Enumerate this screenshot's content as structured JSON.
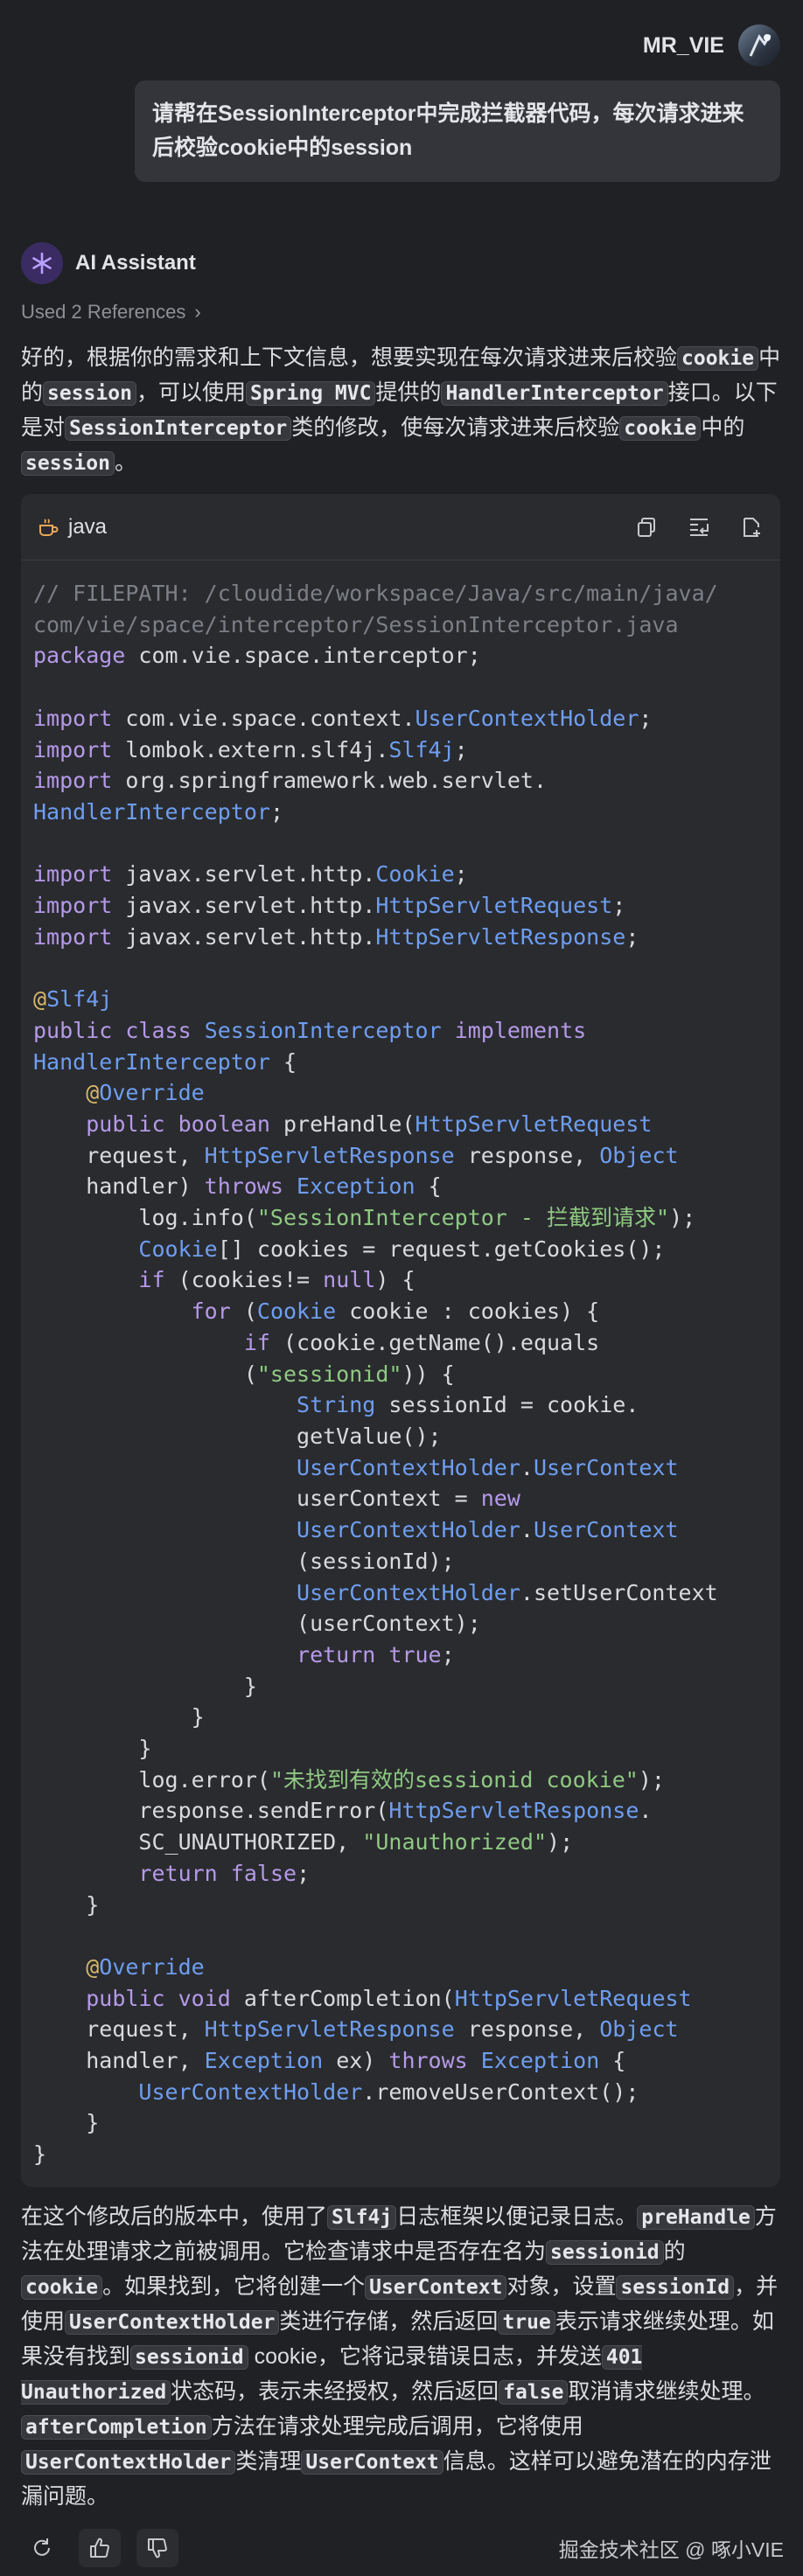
{
  "user": {
    "name": "MR_VIE",
    "message": "请帮在SessionInterceptor中完成拦截器代码，每次请求进来后校验cookie中的session"
  },
  "assistant": {
    "name": "AI Assistant",
    "references": "Used 2 References"
  },
  "intro": {
    "t1": "好的，根据你的需求和上下文信息，想要实现在每次请求进来后校验",
    "c1": "cookie",
    "t2": "中的",
    "c2": "session",
    "t3": "，可以使用",
    "c3": "Spring MVC",
    "t4": "提供的",
    "c4": "HandlerInterceptor",
    "t5": "接口。以下是对",
    "c5": "SessionInterceptor",
    "t6": "类的修改，使每次请求进来后校验",
    "c6": "cookie",
    "t7": "中的",
    "c7": "session",
    "t8": "。"
  },
  "code_block": {
    "language": "java",
    "language_icon": "coffee-cup-icon",
    "actions": [
      "copy-icon",
      "insert-icon",
      "new-file-icon"
    ],
    "lines": [
      "// FILEPATH: /cloudide/workspace/Java/src/main/java/",
      "com/vie/space/interceptor/SessionInterceptor.java",
      "package com.vie.space.interceptor;",
      "",
      "import com.vie.space.context.UserContextHolder;",
      "import lombok.extern.slf4j.Slf4j;",
      "import org.springframework.web.servlet.",
      "HandlerInterceptor;",
      "",
      "import javax.servlet.http.Cookie;",
      "import javax.servlet.http.HttpServletRequest;",
      "import javax.servlet.http.HttpServletResponse;",
      "",
      "@Slf4j",
      "public class SessionInterceptor implements",
      "HandlerInterceptor {",
      "    @Override",
      "    public boolean preHandle(HttpServletRequest",
      "    request, HttpServletResponse response, Object",
      "    handler) throws Exception {",
      "        log.info(\"SessionInterceptor - 拦截到请求\");",
      "        Cookie[] cookies = request.getCookies();",
      "        if (cookies!= null) {",
      "            for (Cookie cookie : cookies) {",
      "                if (cookie.getName().equals",
      "                (\"sessionid\")) {",
      "                    String sessionId = cookie.",
      "                    getValue();",
      "                    UserContextHolder.UserContext",
      "                    userContext = new",
      "                    UserContextHolder.UserContext",
      "                    (sessionId);",
      "                    UserContextHolder.setUserContext",
      "                    (userContext);",
      "                    return true;",
      "                }",
      "            }",
      "        }",
      "        log.error(\"未找到有效的sessionid cookie\");",
      "        response.sendError(HttpServletResponse.",
      "        SC_UNAUTHORIZED, \"Unauthorized\");",
      "        return false;",
      "    }",
      "",
      "    @Override",
      "    public void afterCompletion(HttpServletRequest",
      "    request, HttpServletResponse response, Object",
      "    handler, Exception ex) throws Exception {",
      "        UserContextHolder.removeUserContext();",
      "    }",
      "}"
    ]
  },
  "summary": {
    "t1": "在这个修改后的版本中，使用了",
    "c1": "Slf4j",
    "t2": "日志框架以便记录日志。",
    "c2": "preHandle",
    "t3": "方法在处理请求之前被调用。它检查请求中是否存在名为",
    "c3": "sessionid",
    "t4": "的",
    "c4": "cookie",
    "t5": "。如果找到，它将创建一个",
    "c5": "UserContext",
    "t6": "对象，设置",
    "c6": "sessionId",
    "t7": "，并使用",
    "c7": "UserContextHolder",
    "t8": "类进行存储，然后返回",
    "c8": "true",
    "t9": "表示请求继续处理。如果没有找到",
    "c9": "sessionid",
    "t10": " cookie，它将记录错误日志，并发送",
    "c10": "401 Unauthorized",
    "t11": "状态码，表示未经授权，然后返回",
    "c11": "false",
    "t12": "取消请求继续处理。",
    "c12": "afterCompletion",
    "t13": "方法在请求处理完成后调用，它将使用",
    "c13": "UserContextHolder",
    "t14": "类清理",
    "c14": "UserContext",
    "t15": "信息。这样可以避免潜在的内存泄漏问题。"
  },
  "footer": {
    "buttons": [
      "regenerate-icon",
      "thumbs-up-icon",
      "thumbs-down-icon"
    ],
    "watermark": "掘金技术社区 @ 啄小VIE"
  }
}
